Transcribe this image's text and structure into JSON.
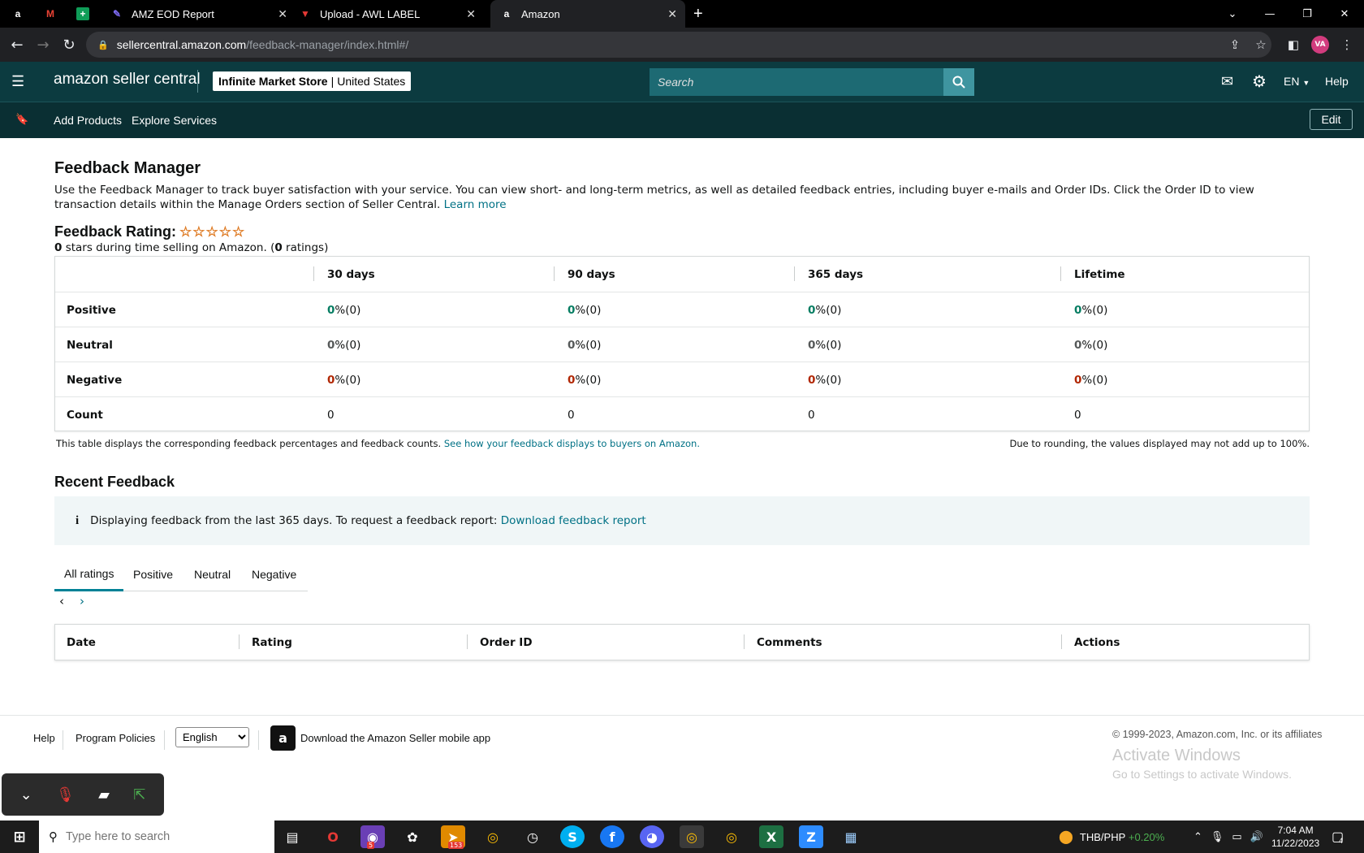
{
  "browser": {
    "tabs": [
      {
        "title": "",
        "icon": "amazon-icon"
      },
      {
        "title": "",
        "icon": "gmail-icon"
      },
      {
        "title": "",
        "icon": "sheets-icon"
      },
      {
        "title": "AMZ EOD Report",
        "icon": "clickup-icon"
      },
      {
        "title": "Upload - AWL LABEL",
        "icon": "awl-icon"
      },
      {
        "title": "Amazon",
        "icon": "amazon-icon"
      }
    ],
    "url_host": "sellercentral.amazon.com",
    "url_path": "/feedback-manager/index.html#/",
    "profile_initials": "VA"
  },
  "header": {
    "logo": "amazon seller central",
    "store_name": "Infinite Market Store",
    "store_region": "United States",
    "search_placeholder": "Search",
    "language": "EN",
    "help": "Help"
  },
  "nav2": {
    "items": [
      "Add Products",
      "Explore Services"
    ],
    "edit": "Edit"
  },
  "page": {
    "title": "Feedback Manager",
    "description": "Use the Feedback Manager to track buyer satisfaction with your service. You can view short- and long-term metrics, as well as detailed feedback entries, including buyer e-mails and Order IDs. Click the Order ID to view transaction details within the Manage Orders section of Seller Central.",
    "learn_more": "Learn more",
    "rating_title": "Feedback Rating:",
    "stars": "☆☆☆☆☆",
    "rating_stars_value": "0",
    "rating_sub_mid": " stars during time selling on Amazon. (",
    "rating_count": "0",
    "rating_sub_end": " ratings)"
  },
  "summary": {
    "columns": [
      "30 days",
      "90 days",
      "365 days",
      "Lifetime"
    ],
    "rows": [
      {
        "label": "Positive",
        "cells": [
          {
            "num": "0",
            "rest": " %(0)"
          },
          {
            "num": "0",
            "rest": " %(0)"
          },
          {
            "num": "0",
            "rest": " %(0)"
          },
          {
            "num": "0",
            "rest": " %(0)"
          }
        ]
      },
      {
        "label": "Neutral",
        "cells": [
          {
            "num": "0",
            "rest": " %(0)"
          },
          {
            "num": "0",
            "rest": " %(0)"
          },
          {
            "num": "0",
            "rest": " %(0)"
          },
          {
            "num": "0",
            "rest": " %(0)"
          }
        ]
      },
      {
        "label": "Negative",
        "cells": [
          {
            "num": "0",
            "rest": " %(0)"
          },
          {
            "num": "0",
            "rest": " %(0)"
          },
          {
            "num": "0",
            "rest": " %(0)"
          },
          {
            "num": "0",
            "rest": " %(0)"
          }
        ]
      },
      {
        "label": "Count",
        "cells": [
          "0",
          "0",
          "0",
          "0"
        ]
      }
    ],
    "note_left": "This table displays the corresponding feedback percentages and feedback counts.",
    "note_link": "See how your feedback displays to buyers on Amazon.",
    "note_right": "Due to rounding, the values displayed may not add up to 100%."
  },
  "recent": {
    "title": "Recent Feedback",
    "info_text": "Displaying feedback from the last 365 days. To request a feedback report:",
    "info_link": "Download feedback report",
    "tabs": [
      "All ratings",
      "Positive",
      "Neutral",
      "Negative"
    ],
    "columns": [
      "Date",
      "Rating",
      "Order ID",
      "Comments",
      "Actions"
    ]
  },
  "footer": {
    "links": [
      "Help",
      "Program Policies"
    ],
    "language": "English",
    "app_text": "Download the Amazon Seller mobile app",
    "copyright": "© 1999-2023, Amazon.com, Inc. or its affiliates",
    "activate_title": "Activate Windows",
    "activate_sub": "Go to Settings to activate Windows."
  },
  "taskbar": {
    "search_placeholder": "Type here to search",
    "badge_opera": "5",
    "badge_telegram": "153",
    "currency": "THB/PHP",
    "currency_change": "+0.20%",
    "time": "7:04 AM",
    "date": "11/22/2023",
    "notifications": "4"
  },
  "colors": {
    "header_bg": "#0c3b40",
    "nav_bg": "#0a2f33",
    "link": "#007185",
    "positive": "#067d62",
    "negative": "#b12704"
  }
}
